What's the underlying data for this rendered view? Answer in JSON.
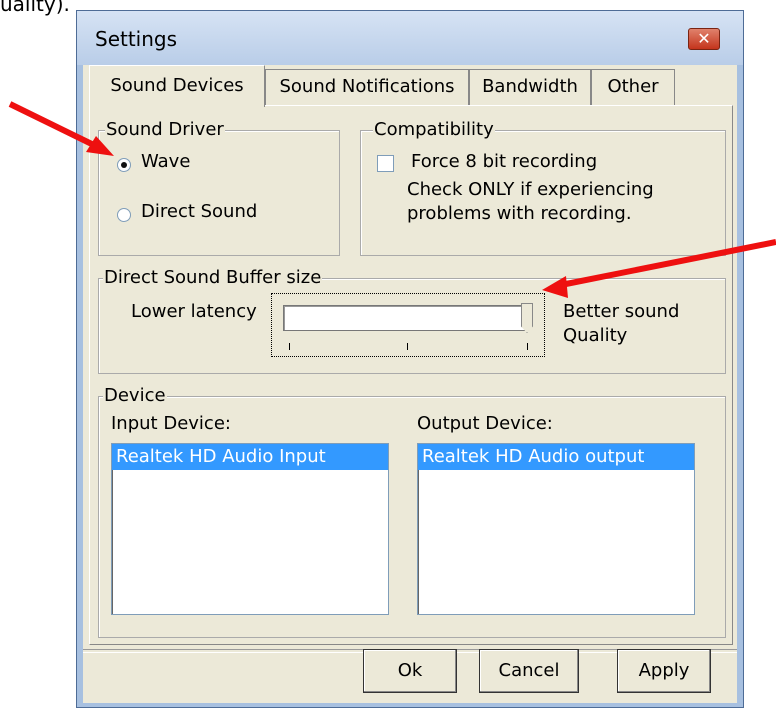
{
  "annotation": {
    "top_text": "uality)."
  },
  "window": {
    "title": "Settings",
    "close_icon": "close-icon",
    "colors": {
      "titlebar": "#b9cde8",
      "close": "#c4341c",
      "selection": "#3399ff",
      "arrow": "#ee1010"
    }
  },
  "tabs": [
    {
      "label": "Sound Devices",
      "active": true
    },
    {
      "label": "Sound Notifications",
      "active": false
    },
    {
      "label": "Bandwidth",
      "active": false
    },
    {
      "label": "Other",
      "active": false
    }
  ],
  "sound_driver": {
    "legend": "Sound Driver",
    "options": [
      {
        "label": "Wave",
        "selected": true
      },
      {
        "label": "Direct Sound",
        "selected": false
      }
    ]
  },
  "compatibility": {
    "legend": "Compatibility",
    "checkbox_label": "Force 8 bit recording",
    "checked": false,
    "note_line1": "Check ONLY if experiencing",
    "note_line2": "problems with recording."
  },
  "buffer": {
    "legend": "Direct Sound Buffer size",
    "left_label": "Lower latency",
    "right_label_line1": "Better sound",
    "right_label_line2": "Quality",
    "slider_position": 1.0,
    "tick_count": 3
  },
  "device": {
    "legend": "Device",
    "input_label": "Input Device:",
    "input_items": [
      "Realtek HD Audio Input"
    ],
    "output_label": "Output Device:",
    "output_items": [
      "Realtek HD Audio output"
    ]
  },
  "buttons": {
    "ok": "Ok",
    "cancel": "Cancel",
    "apply": "Apply"
  }
}
